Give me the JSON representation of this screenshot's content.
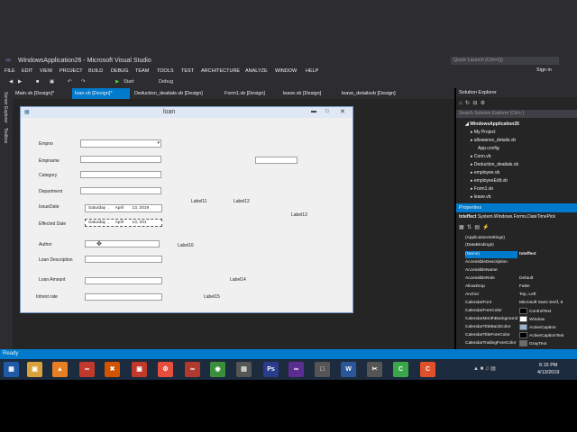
{
  "window": {
    "title": "WindowsApplication26 - Microsoft Visual Studio",
    "quick_launch_placeholder": "Quick Launch (Ctrl+Q)"
  },
  "menu": [
    "FILE",
    "EDIT",
    "VIEW",
    "PROJECT",
    "BUILD",
    "DEBUG",
    "TEAM",
    "TOOLS",
    "TEST",
    "ARCHITECTURE",
    "ANALYZE",
    "WINDOW",
    "HELP"
  ],
  "sign_in": "Sign in",
  "toolbar": {
    "start": "Start",
    "config": "Debug"
  },
  "side_tabs": [
    "Server Explorer",
    "Toolbox"
  ],
  "tabs": [
    {
      "label": "Main.vb [Design]*",
      "active": false
    },
    {
      "label": "loan.vb [Design]*",
      "active": true
    },
    {
      "label": "Deduction_deatials.vb [Design]",
      "active": false
    },
    {
      "label": "Form1.vb [Design]",
      "active": false
    },
    {
      "label": "leave.vb [Design]",
      "active": false
    },
    {
      "label": "leave_detailsvb [Design]",
      "active": false
    }
  ],
  "form": {
    "title": "loan",
    "labels": {
      "empno": "Empno",
      "empname": "Empname",
      "category": "Category",
      "department": "Department",
      "issuedate": "IssueDate",
      "effected": "Effected Date",
      "author": "Author",
      "loandesc": "Loan Description",
      "loanamount": "Loan Amount",
      "interest": "Intrest rate",
      "l11": "Label11",
      "l12": "Label12",
      "l13": "Label13",
      "l14": "Label14",
      "l15": "Label15",
      "l16": "Label16"
    },
    "date1": "Saturday  ,     April       13, 2019",
    "date2": "Saturday  ,     April       13, 201"
  },
  "solution": {
    "title": "Solution Explorer",
    "search_placeholder": "Search Solution Explorer (Ctrl+;)",
    "root": "WindowsApplication26",
    "items": [
      "My Project",
      "allowance_details.vb",
      "App.config",
      "Conn.vb",
      "Deduction_deatials.vb",
      "employee.vb",
      "employeeEdit.vb",
      "Form1.vb",
      "leave.vb"
    ]
  },
  "properties": {
    "title": "Properties",
    "object_name": "txteffect",
    "object_type": "System.Windows.Forms.DateTimePick",
    "rows": [
      {
        "name": "(ApplicationSettings)",
        "value": "",
        "group": true
      },
      {
        "name": "(DataBindings)",
        "value": "",
        "group": true
      },
      {
        "name": "(Name)",
        "value": "txteffect",
        "selected": true
      },
      {
        "name": "AccessibleDescription",
        "value": ""
      },
      {
        "name": "AccessibleName",
        "value": ""
      },
      {
        "name": "AccessibleRole",
        "value": "Default"
      },
      {
        "name": "AllowDrop",
        "value": "False"
      },
      {
        "name": "Anchor",
        "value": "Top, Left"
      },
      {
        "name": "CalendarFont",
        "value": "Microsoft Sans Serif, 8"
      },
      {
        "name": "CalendarForeColor",
        "value": "ControlText",
        "swatch": "#000000"
      },
      {
        "name": "CalendarMonthBackground",
        "value": "Window",
        "swatch": "#ffffff"
      },
      {
        "name": "CalendarTitleBackColor",
        "value": "ActiveCaption",
        "swatch": "#99b4d1"
      },
      {
        "name": "CalendarTitleForeColor",
        "value": "ActiveCaptionText",
        "swatch": "#000000"
      },
      {
        "name": "CalendarTrailingForeColor",
        "value": "GrayText",
        "swatch": "#6d6d6d"
      }
    ]
  },
  "status": "Ready",
  "clock": {
    "time": "6:15 PM",
    "date": "4/13/2019"
  },
  "colors": {
    "accent": "#007acc",
    "chrome": "#2d2d30",
    "editor": "#252526"
  }
}
